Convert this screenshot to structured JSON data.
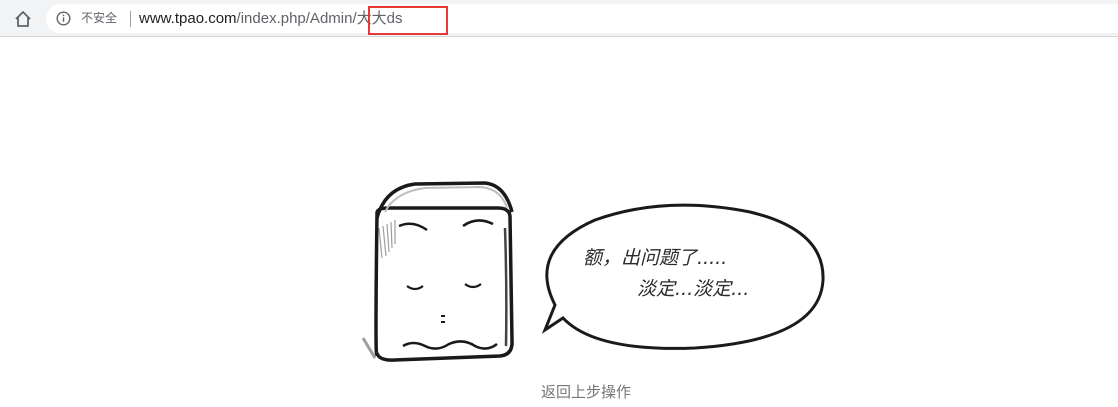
{
  "browser": {
    "home_icon": "home-icon",
    "security_icon": "info-icon",
    "security_label": "不安全",
    "url_host": "www.tpao.com",
    "url_path": "/index.php/Admin/大大ds",
    "highlight_color": "#e53935"
  },
  "error_page": {
    "illustration_icon": "sad-cube-icon",
    "message_line1": "额，出问题了.....",
    "message_line2": "淡定...淡定...",
    "back_link": "返回上步操作"
  }
}
